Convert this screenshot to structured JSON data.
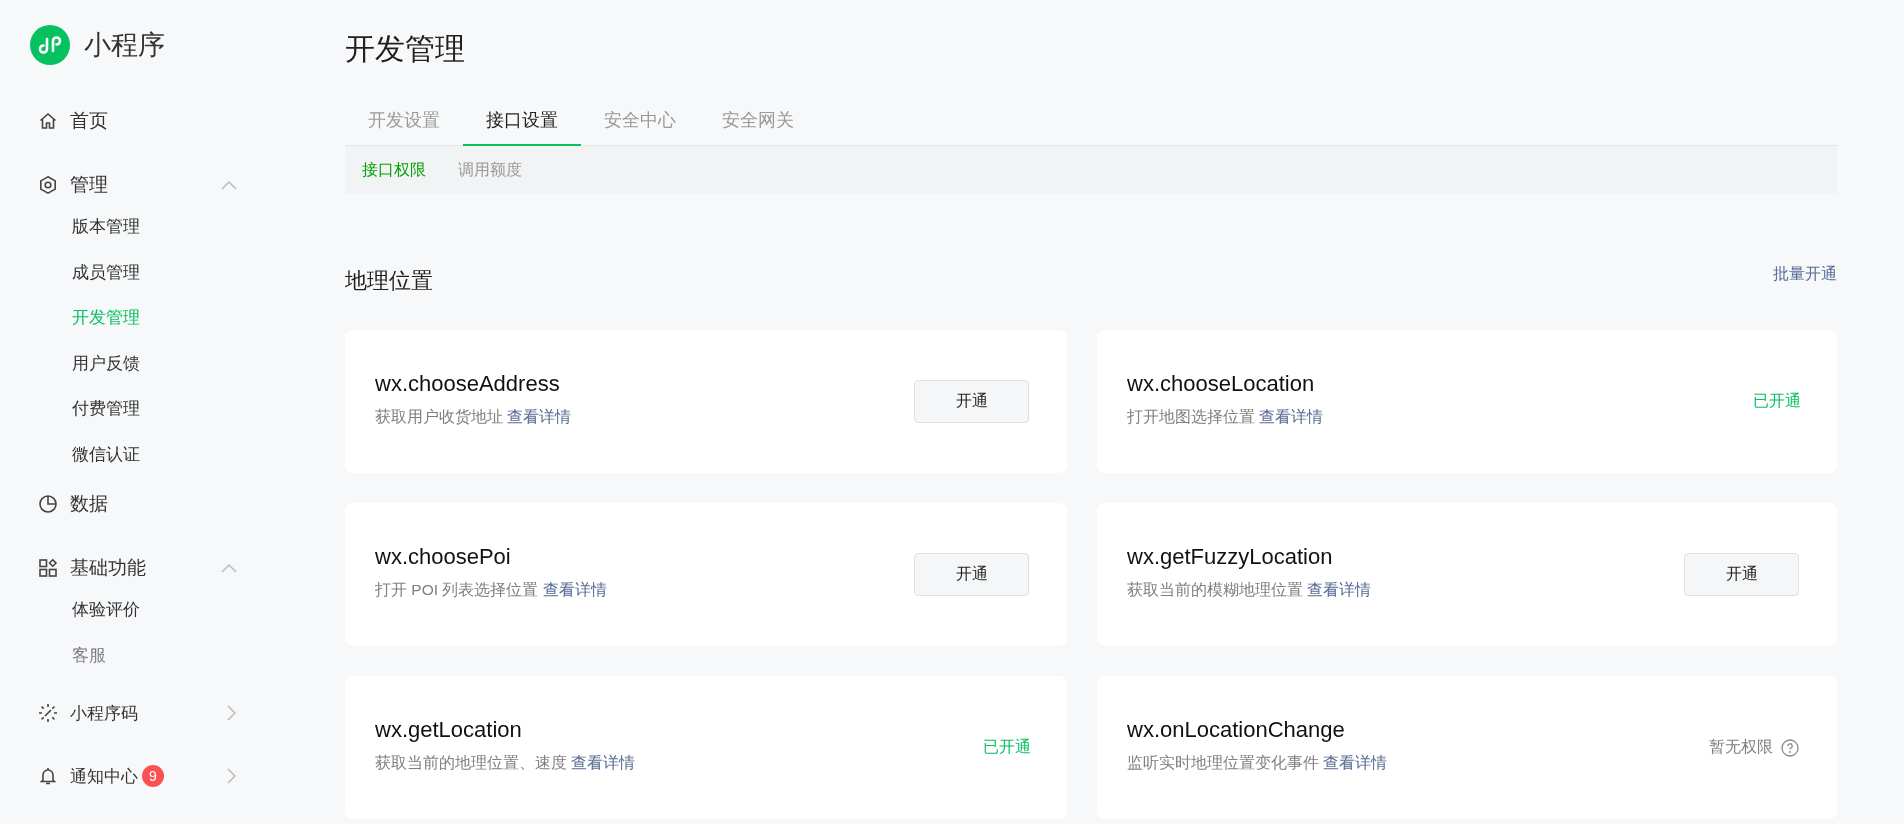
{
  "app": {
    "name": "小程序"
  },
  "sidebar": {
    "items": [
      {
        "label": "首页"
      },
      {
        "label": "管理",
        "expanded": true,
        "children": [
          {
            "label": "版本管理",
            "selected": false
          },
          {
            "label": "成员管理",
            "selected": false
          },
          {
            "label": "开发管理",
            "selected": true
          },
          {
            "label": "用户反馈",
            "selected": false
          },
          {
            "label": "付费管理",
            "selected": false
          },
          {
            "label": "微信认证",
            "selected": false
          }
        ]
      },
      {
        "label": "数据"
      },
      {
        "label": "基础功能",
        "expanded": true,
        "children": [
          {
            "label": "体验评价",
            "selected": false
          },
          {
            "label": "客服",
            "selected": false
          }
        ]
      },
      {
        "label": "小程序码",
        "expanded": false
      },
      {
        "label": "通知中心",
        "expanded": false,
        "badge": "9"
      }
    ]
  },
  "page": {
    "title": "开发管理"
  },
  "tabs": [
    {
      "label": "开发设置",
      "selected": false
    },
    {
      "label": "接口设置",
      "selected": true
    },
    {
      "label": "安全中心",
      "selected": false
    },
    {
      "label": "安全网关",
      "selected": false
    }
  ],
  "sub_tabs": [
    {
      "label": "接口权限",
      "selected": true
    },
    {
      "label": "调用额度",
      "selected": false
    }
  ],
  "section": {
    "title": "地理位置",
    "action": "批量开通"
  },
  "apis": [
    {
      "name": "wx.chooseAddress",
      "description": "获取用户收货地址",
      "link": "查看详情",
      "status": {
        "kind": "button",
        "label": "开通"
      }
    },
    {
      "name": "wx.chooseLocation",
      "description": "打开地图选择位置",
      "link": "查看详情",
      "status": {
        "kind": "enabled",
        "label": "已开通"
      }
    },
    {
      "name": "wx.choosePoi",
      "description": "打开 POI 列表选择位置",
      "link": "查看详情",
      "status": {
        "kind": "button",
        "label": "开通"
      }
    },
    {
      "name": "wx.getFuzzyLocation",
      "description": "获取当前的模糊地理位置",
      "link": "查看详情",
      "status": {
        "kind": "button",
        "label": "开通"
      }
    },
    {
      "name": "wx.getLocation",
      "description": "获取当前的地理位置、速度",
      "link": "查看详情",
      "status": {
        "kind": "enabled",
        "label": "已开通"
      }
    },
    {
      "name": "wx.onLocationChange",
      "description": "监听实时地理位置变化事件",
      "link": "查看详情",
      "status": {
        "kind": "no_permission",
        "label": "暂无权限"
      }
    }
  ]
}
